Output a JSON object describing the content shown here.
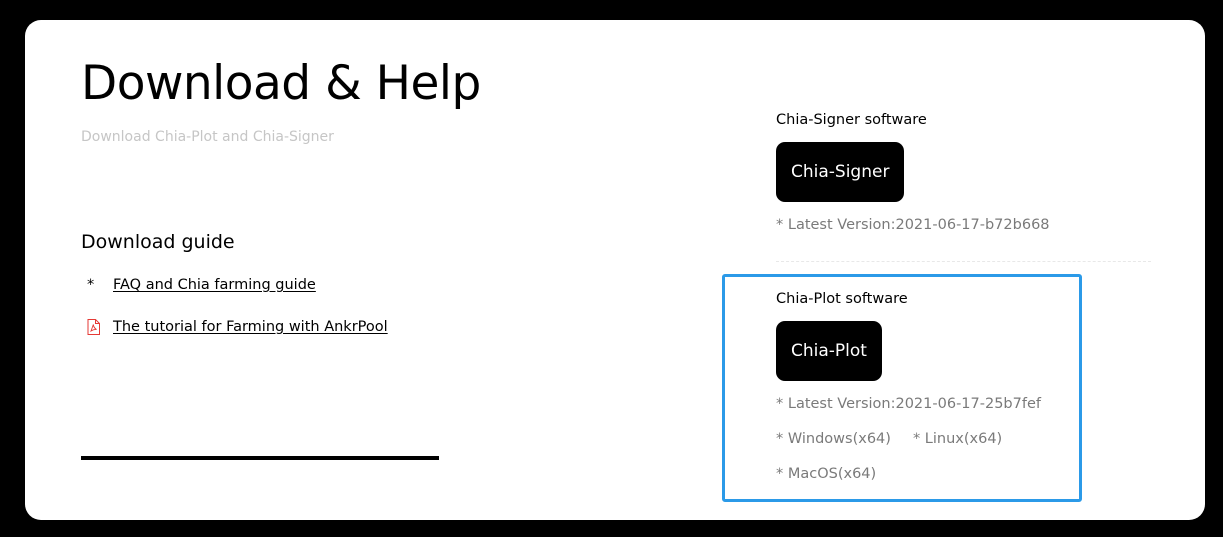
{
  "page": {
    "title": "Download & Help",
    "subtitle": "Download Chia-Plot and Chia-Signer"
  },
  "guide": {
    "heading": "Download guide",
    "items": [
      {
        "marker": "*",
        "label": "FAQ and Chia farming guide",
        "icon": "asterisk"
      },
      {
        "marker": "",
        "label": "The tutorial for Farming with AnkrPool",
        "icon": "pdf-icon"
      }
    ]
  },
  "signer": {
    "label": "Chia-Signer software",
    "button": "Chia-Signer",
    "version": "* Latest Version:2021-06-17-b72b668"
  },
  "plot": {
    "label": "Chia-Plot software",
    "button": "Chia-Plot",
    "version": "* Latest Version:2021-06-17-25b7fef",
    "platforms": [
      "* Windows(x64)",
      "* Linux(x64)",
      "* MacOS(x64)"
    ]
  },
  "colors": {
    "background": "#000000",
    "card": "#ffffff",
    "button": "#000000",
    "muted_text": "#7a7a7a",
    "subtitle_text": "#c6c6c6",
    "focus_border": "#2b9ae8",
    "pdf_icon": "#e53935"
  }
}
